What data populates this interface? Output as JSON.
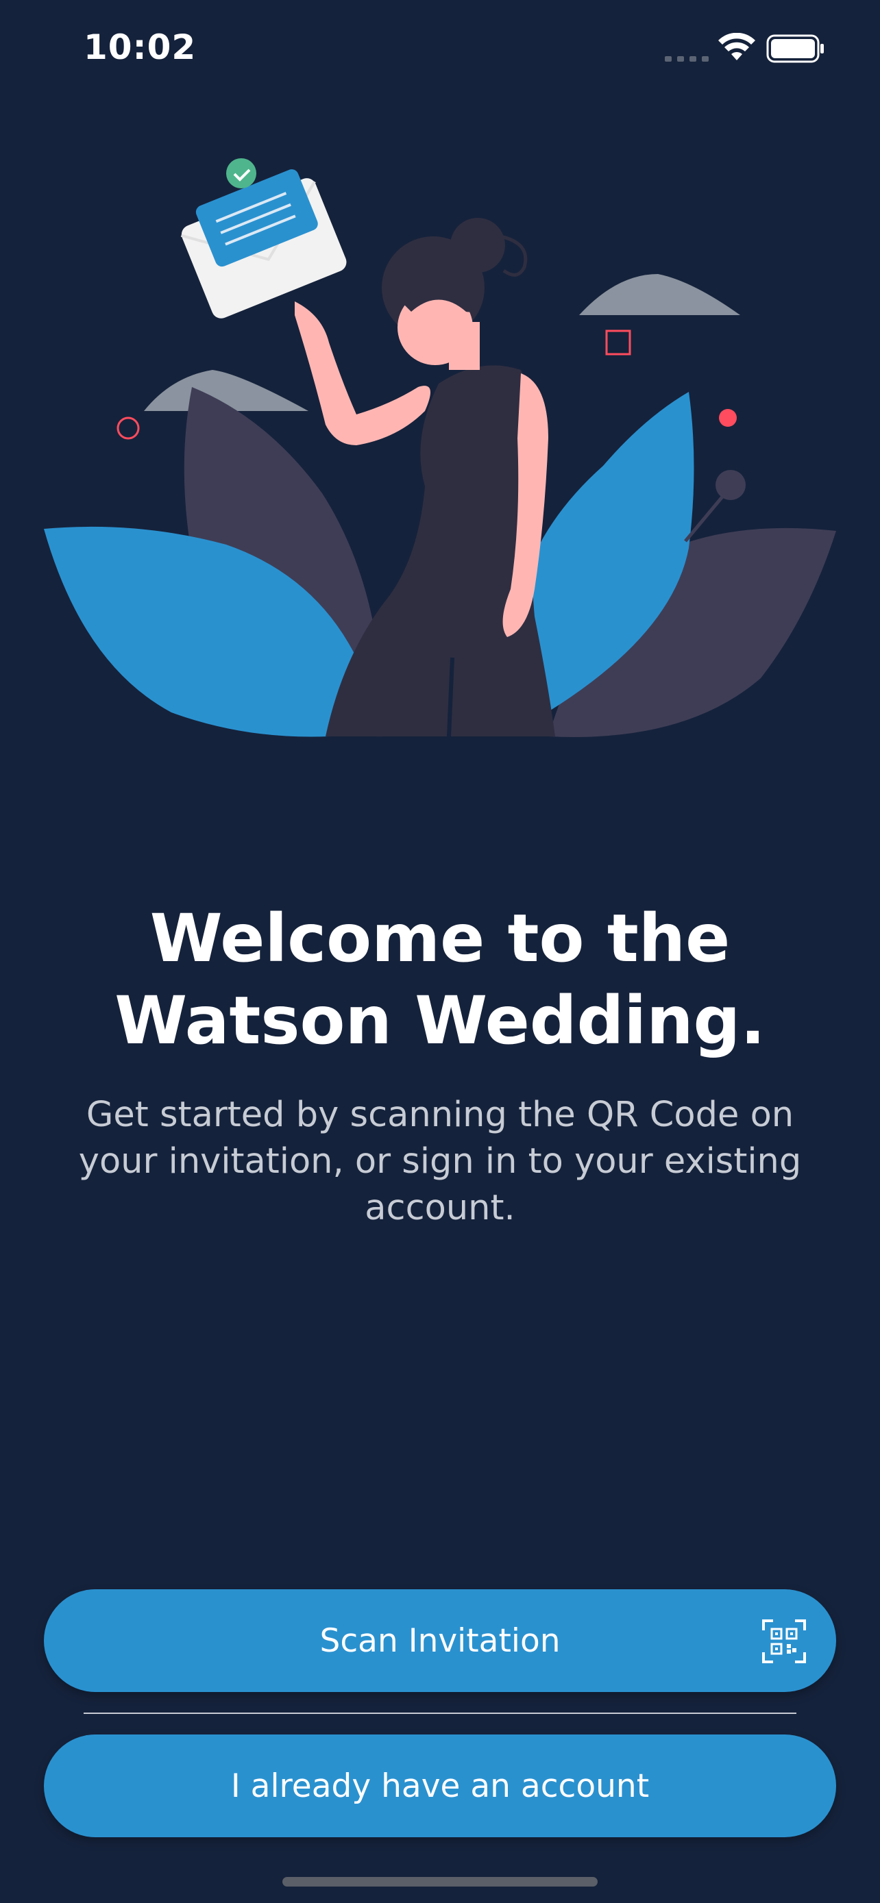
{
  "status_bar": {
    "time": "10:02"
  },
  "welcome": {
    "title_line1": "Welcome to the",
    "title_line2": "Watson Wedding.",
    "subtitle": "Get started by scanning the QR Code on your invitation, or sign in to your existing account."
  },
  "actions": {
    "scan_label": "Scan Invitation",
    "account_label": "I already have an account"
  },
  "colors": {
    "background": "#15223b",
    "accent": "#2a91cf",
    "skin": "#ffb6b3",
    "dress": "#2f2e41",
    "leaf_dark": "#3f3d56",
    "decor_red": "#ff4c5e",
    "check_green": "#4fb58d"
  },
  "icons": {
    "qr": "qr-code-icon",
    "wifi": "wifi-icon",
    "battery": "battery-icon",
    "signal": "signal-icon"
  }
}
